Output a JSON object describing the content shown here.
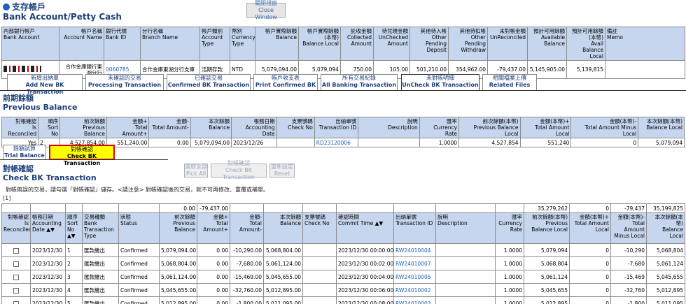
{
  "page": {
    "title_cn": "支存帳戶",
    "title_en": "Bank Account/Petty Cash",
    "close_cn": "關閉視窗",
    "close_en": "Close Window"
  },
  "account_table": {
    "headers": [
      {
        "cn": "內部銀行帳戶",
        "en": "Bank Account",
        "align": "l"
      },
      {
        "cn": "帳戶名稱",
        "en": "Account Name",
        "align": "r"
      },
      {
        "cn": "銀行代號",
        "en": "Bank ID",
        "align": "l"
      },
      {
        "cn": "分行名稱",
        "en": "Branch Name",
        "align": "l"
      },
      {
        "cn": "帳戶類別",
        "en": "Account Type",
        "align": "l"
      },
      {
        "cn": "幣別",
        "en": "Currency Type",
        "align": "l"
      },
      {
        "cn": "帳戶實際餘額",
        "en": "Balance",
        "align": "r"
      },
      {
        "cn": "帳戶實際餘額(本幣)",
        "en": "Balance Local",
        "align": "r"
      },
      {
        "cn": "託收金額",
        "en": "Collected Amount",
        "align": "r"
      },
      {
        "cn": "待兌現金額",
        "en": "UnChecked Amount",
        "align": "r"
      },
      {
        "cn": "其他待入帳",
        "en": "Other Pending Deposit",
        "align": "r"
      },
      {
        "cn": "其他待扣帳",
        "en": "Other Pending Withdraw",
        "align": "r"
      },
      {
        "cn": "未對帳金額",
        "en": "UnReconciled",
        "align": "r"
      },
      {
        "cn": "預計可用餘額",
        "en": "Available Balance",
        "align": "r"
      },
      {
        "cn": "預計可用餘額(本幣)",
        "en": "Avail Balance Local",
        "align": "r"
      },
      {
        "cn": "備註",
        "en": "Memo",
        "align": "l"
      }
    ],
    "row": [
      "",
      "合作金庫銀行東湖分行",
      "0060785",
      "合作金庫東湖分行支庫",
      "活期存款",
      "NTD",
      "5,079,094.00",
      "5,079,094",
      "750.00",
      "105.00",
      "501,210.00",
      "354,962.00",
      "-79,437.00",
      "5,145,905.00",
      "5,139,815",
      ""
    ]
  },
  "tabs": [
    {
      "cn": "新增出納單",
      "en": "Add New BK Transaction"
    },
    {
      "cn": "未確認的交易",
      "en": "Processing Transaction"
    },
    {
      "cn": "已確認交易",
      "en": "Confirmed BK Transaction"
    },
    {
      "cn": "帳戶收支表",
      "en": "Print Confirmed BK"
    },
    {
      "cn": "所有交易紀錄",
      "en": "All Banking Transaction"
    },
    {
      "cn": "未對帳明細",
      "en": "UnCheck BK Transaction"
    },
    {
      "cn": "相關檔案上傳",
      "en": "Related Files"
    }
  ],
  "previous": {
    "title_cn": "前期餘額",
    "title_en": "Previous Balance",
    "headers": [
      {
        "cn": "對帳確認",
        "en": "Is Reconciled"
      },
      {
        "cn": "順序",
        "en": "Sort No"
      },
      {
        "cn": "前次餘額",
        "en": "Previous Balance"
      },
      {
        "cn": "金額+",
        "en": "Total Amount+"
      },
      {
        "cn": "金額-",
        "en": "Total Amount-"
      },
      {
        "cn": "本次餘額",
        "en": "Balance"
      },
      {
        "cn": "帳務日期",
        "en": "Accounting Date"
      },
      {
        "cn": "支票號碼",
        "en": "Check No"
      },
      {
        "cn": "出納單號",
        "en": "Transaction ID"
      },
      {
        "cn": "說明",
        "en": "Description"
      },
      {
        "cn": "匯率",
        "en": "Currency Rate"
      },
      {
        "cn": "前次餘額(本幣)",
        "en": "Previous Balance Local"
      },
      {
        "cn": "金額(本幣)+",
        "en": "Total Amount Local"
      },
      {
        "cn": "金額(本幣)-",
        "en": "Total Amount Minus Local"
      },
      {
        "cn": "本次餘額(本幣)",
        "en": "Balance Local"
      }
    ],
    "row": [
      "Yes",
      "2",
      "4,527,854.00",
      "551,240.00",
      "0.00",
      "5,079,094.00",
      "2023/12/26",
      "",
      "RD23120006",
      "",
      "1.0000",
      "4,527,854",
      "551,240",
      "0",
      "5,079,094"
    ]
  },
  "subtabs": [
    {
      "cn": "餘額試算",
      "en": "Trial Balance"
    },
    {
      "cn": "對帳確認",
      "en": "Check BK Transaction"
    }
  ],
  "check": {
    "title_cn": "對帳確認",
    "title_en": "Check BK Transaction",
    "buttons": [
      {
        "cn": "選取全部",
        "en": "Pick All"
      },
      {
        "cn": "對帳確認",
        "en": "Check BK Transaction"
      },
      {
        "cn": "重新設定",
        "en": "Reset"
      }
    ],
    "note": "對帳無誤的交易，請勾選「對帳確認」儲存。<請注意> 對帳確認後的交易，就不可再修改、重覆或補單。",
    "count": "[1]",
    "sum_row": [
      "",
      "",
      "",
      "",
      "",
      "0.00",
      "-79,437.00",
      "",
      "",
      "",
      "",
      "",
      "",
      "",
      "35,279,262",
      "0",
      "-79,437",
      "35,199,825"
    ],
    "headers": [
      {
        "cn": "對帳確認",
        "en": "Is Reconciled"
      },
      {
        "cn": "帳務日期",
        "en": "Accounting Date ▲▼"
      },
      {
        "cn": "順序",
        "en": "Sort No ▲▼"
      },
      {
        "cn": "交易種類",
        "en": "Bank Transaction Type"
      },
      {
        "cn": "狀態",
        "en": "Status"
      },
      {
        "cn": "前次餘額",
        "en": "Previous Balance"
      },
      {
        "cn": "金額+",
        "en": "Total Amount+"
      },
      {
        "cn": "金額-",
        "en": "Total Amount-"
      },
      {
        "cn": "本次餘額",
        "en": "Balance"
      },
      {
        "cn": "支票號碼",
        "en": "Check No"
      },
      {
        "cn": "確認時間",
        "en": "Commit Time ▲▼"
      },
      {
        "cn": "出納單號",
        "en": "Transaction ID"
      },
      {
        "cn": "說明",
        "en": "Description"
      },
      {
        "cn": "匯率",
        "en": "Currency Rate"
      },
      {
        "cn": "前次餘額(本幣)",
        "en": "Previous Balance Local"
      },
      {
        "cn": "金額(本幣)+",
        "en": "Total Amount Local"
      },
      {
        "cn": "金額(本幣)-",
        "en": "Total Amount Minus Local"
      },
      {
        "cn": "本次餘額(本幣)",
        "en": "Balance Local"
      }
    ],
    "rows": [
      [
        "",
        "2023/12/30",
        "1",
        "匯款繳出",
        "Confirmed",
        "5,079,094.00",
        "0.00",
        "-10,290.00",
        "5,068,804.00",
        "",
        "2023/12/30 00:00:00",
        "RW24010004",
        "",
        "1.0000",
        "5,079,094",
        "0",
        "-10,290",
        "5,068,804"
      ],
      [
        "",
        "2023/12/30",
        "2",
        "匯款繳出",
        "Confirmed",
        "5,068,804.00",
        "0.00",
        "-7,680.00",
        "5,061,124.00",
        "",
        "2023/12/30 00:02:00",
        "RW24010007",
        "",
        "1.0000",
        "5,068,804",
        "0",
        "-7,680",
        "5,061,124"
      ],
      [
        "",
        "2023/12/30",
        "3",
        "匯款繳出",
        "Confirmed",
        "5,061,124.00",
        "0.00",
        "-15,469.00",
        "5,045,655.00",
        "",
        "2023/12/30 00:04:00",
        "RW24010005",
        "",
        "1.0000",
        "5,061,124",
        "0",
        "-15,469",
        "5,045,655"
      ],
      [
        "",
        "2023/12/30",
        "4",
        "匯款繳出",
        "Confirmed",
        "5,045,655.00",
        "0.00",
        "-32,760.00",
        "5,012,895.00",
        "",
        "2023/12/30 00:06:00",
        "RW24010002",
        "",
        "1.0000",
        "5,045,655",
        "0",
        "-32,760",
        "5,012,895"
      ],
      [
        "",
        "2023/12/30",
        "5",
        "匯款繳出",
        "Confirmed",
        "5,012,895.00",
        "0.00",
        "-1,800.00",
        "5,011,095.00",
        "",
        "2023/12/30 00:08:00",
        "RW24010003",
        "",
        "1.0000",
        "5,012,895",
        "0",
        "-1,800",
        "5,011,095"
      ]
    ]
  },
  "colors": {
    "header_bg": "#c6d6ee",
    "title": "#1f3f7a",
    "active_subtab": "#ffff00",
    "highlight_border": "#e00000"
  }
}
